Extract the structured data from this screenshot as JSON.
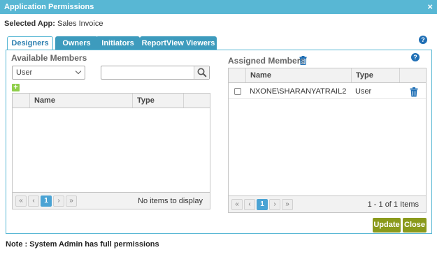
{
  "dialog": {
    "title": "Application Permissions",
    "close_glyph": "×"
  },
  "selected_app": {
    "label": "Selected App:",
    "value": "Sales Invoice"
  },
  "tabs": [
    {
      "label": "Designers",
      "active": true
    },
    {
      "label": "Owners",
      "active": false
    },
    {
      "label": "Initiators",
      "active": false
    },
    {
      "label": "ReportView Viewers",
      "active": false
    }
  ],
  "help_glyph": "?",
  "available": {
    "title": "Available Members",
    "type_select": {
      "value": "User"
    },
    "search": {
      "value": "",
      "placeholder": ""
    },
    "add_glyph": "+",
    "columns": [
      "Name",
      "Type"
    ],
    "rows": [],
    "pager": {
      "first": "«",
      "prev": "‹",
      "page": "1",
      "next": "›",
      "last": "»",
      "info": "No items to display"
    }
  },
  "assigned": {
    "title": "Assigned Members",
    "columns": [
      "Name",
      "Type"
    ],
    "rows": [
      {
        "name": "NXONE\\SHARANYATRAIL2",
        "type": "User",
        "checked": false
      }
    ],
    "pager": {
      "first": "«",
      "prev": "‹",
      "page": "1",
      "next": "›",
      "last": "»",
      "info": "1 - 1 of 1 Items"
    }
  },
  "buttons": {
    "update": "Update",
    "close": "Close"
  },
  "note": "Note : System Admin has full permissions",
  "colors": {
    "titlebar": "#58b7d4",
    "tab_inactive": "#3d9bbd",
    "page_active": "#4aa3d4",
    "button": "#8a9a1b",
    "add_icon": "#8fce4a",
    "trash_icon": "#1f6fb5"
  }
}
